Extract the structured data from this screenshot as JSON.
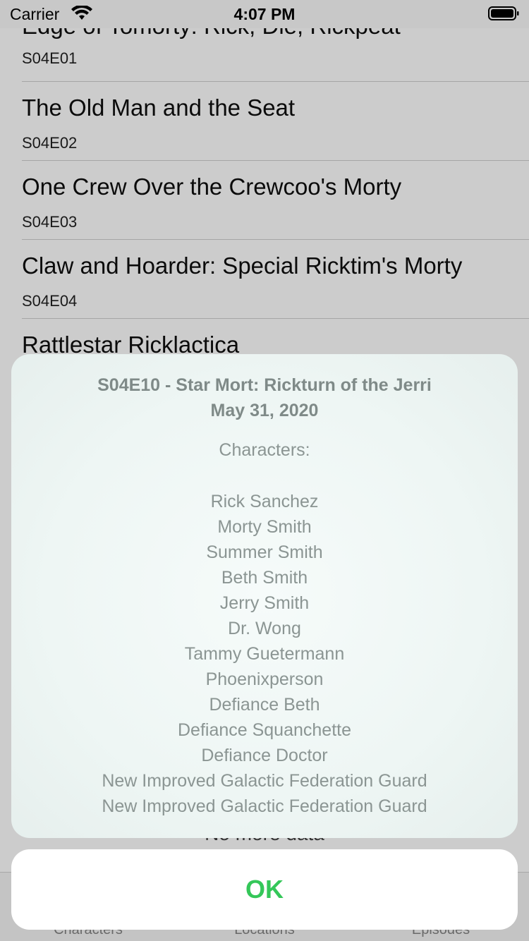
{
  "status_bar": {
    "carrier": "Carrier",
    "time": "4:07 PM"
  },
  "episodes": [
    {
      "title": "Edge of Tomorty: Rick, Die, Rickpeat",
      "code": "S04E01"
    },
    {
      "title": "The Old Man and the Seat",
      "code": "S04E02"
    },
    {
      "title": "One Crew Over the Crewcoo's Morty",
      "code": "S04E03"
    },
    {
      "title": "Claw and Hoarder: Special Ricktim's Morty",
      "code": "S04E04"
    },
    {
      "title": "Rattlestar Ricklactica",
      "code": ""
    }
  ],
  "list_footer": "No more data",
  "tabs": [
    {
      "label": "Characters"
    },
    {
      "label": "Locations"
    },
    {
      "label": "Episodes"
    }
  ],
  "alert": {
    "title": "S04E10 - Star Mort: Rickturn of the Jerri",
    "date": "May 31, 2020",
    "characters_header": "Characters:",
    "characters": [
      "Rick Sanchez",
      "Morty Smith",
      "Summer Smith",
      "Beth Smith",
      "Jerry Smith",
      "Dr. Wong",
      "Tammy Guetermann",
      "Phoenixperson",
      "Defiance Beth",
      "Defiance Squanchette",
      "Defiance Doctor",
      "New Improved Galactic Federation Guard",
      "New Improved Galactic Federation Guard"
    ],
    "ok_label": "OK"
  },
  "colors": {
    "accent": "#34c759"
  }
}
